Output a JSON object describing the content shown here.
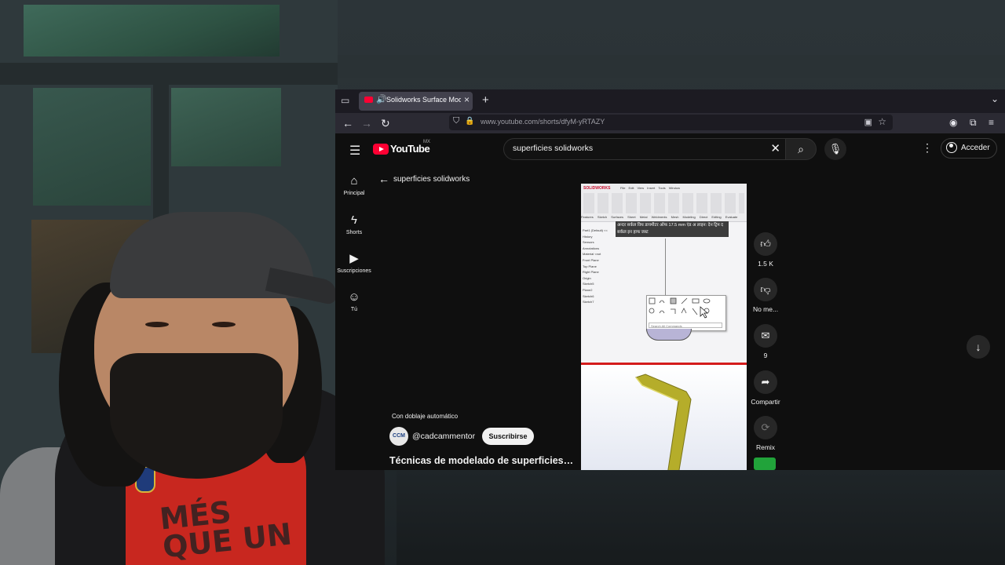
{
  "tab": {
    "title": "Solidworks Surface Mod"
  },
  "address_bar": {
    "url": "www.youtube.com/shorts/dfyM-yRTAZY"
  },
  "youtube": {
    "logo": "YouTube",
    "region": "MX",
    "search_query": "superficies solidworks",
    "sign_in_label": "Acceder",
    "sidebar": [
      {
        "label": "Principal",
        "icon": "home-icon"
      },
      {
        "label": "Shorts",
        "icon": "shorts-icon"
      },
      {
        "label": "Suscripciones",
        "icon": "subscriptions-icon"
      },
      {
        "label": "Tú",
        "icon": "you-icon"
      }
    ],
    "back_label": "superficies solidworks",
    "dub_label": "Con doblaje automático",
    "channel": {
      "avatar_text": "CCM",
      "handle": "@cadcammentor",
      "subscribe_label": "Suscribirse"
    },
    "video_title": "Técnicas de modelado de superficies…",
    "video_frame": {
      "brand": "SOLIDWORKS",
      "menu": "File Edit View Insert Tools Window",
      "tabs": "Features Sketch Surfaces Sheet Metal Weldments Mesh Modeling Direct Editing Evaluate",
      "caption": "अन्दर सर्कल विथ डायमीटर ऑफ 17.5 mm एंड अ लाइन: देन ट्रिम द सर्कल इन हाफ जस्ट",
      "tree": [
        "Part1 (Default) <<",
        "History",
        "Sensors",
        "Annotations",
        "Material <not",
        "Front Plane",
        "Top Plane",
        "Right Plane",
        "Origin",
        "Sketch5",
        "Plane2",
        "Sketch6",
        "Sketch7"
      ],
      "search_commands": "Search All Commands"
    },
    "actions": [
      {
        "name": "like",
        "label": "1.5 K",
        "icon": "thumbs-up-icon"
      },
      {
        "name": "dislike",
        "label": "No me...",
        "icon": "thumbs-down-icon"
      },
      {
        "name": "comments",
        "label": "9",
        "icon": "comment-icon"
      },
      {
        "name": "share",
        "label": "Compartir",
        "icon": "share-icon"
      },
      {
        "name": "remix",
        "label": "Remix",
        "icon": "remix-icon"
      }
    ]
  },
  "colors": {
    "youtube_red": "#ff0033",
    "background": "#0f0f0f",
    "tab_active": "#42414d"
  }
}
